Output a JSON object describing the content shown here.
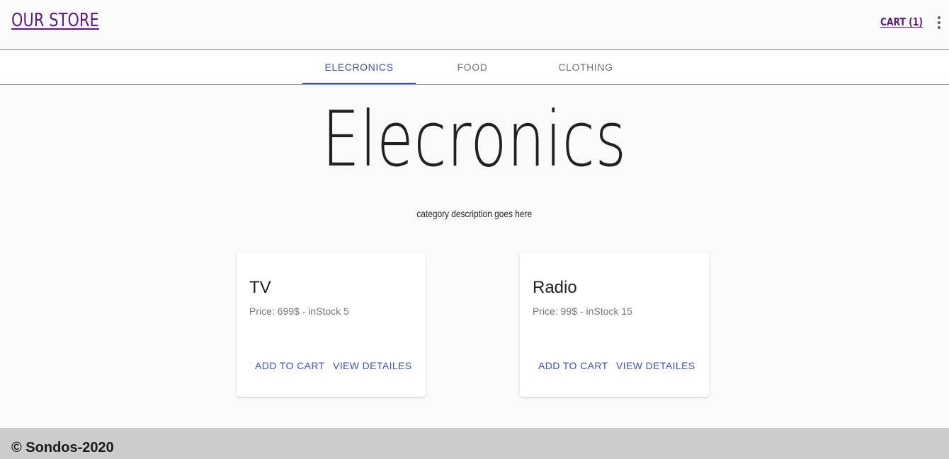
{
  "header": {
    "brand": "OUR STORE",
    "cart_label": "CART (1)",
    "menu_icon": "more-vert-icon"
  },
  "tabs": [
    {
      "label": "ELECRONICS",
      "active": true
    },
    {
      "label": "FOOD",
      "active": false
    },
    {
      "label": "CLOTHING",
      "active": false
    }
  ],
  "category": {
    "title": "Elecronics",
    "description": "category description goes here"
  },
  "products": [
    {
      "name": "TV",
      "details": "Price: 699$ - inStock 5",
      "add_label": "ADD TO CART",
      "view_label": "VIEW DETAILES"
    },
    {
      "name": "Radio",
      "details": "Price: 99$ - inStock 15",
      "add_label": "ADD TO CART",
      "view_label": "VIEW DETAILES"
    }
  ],
  "footer": {
    "text": "© Sondos-2020"
  },
  "colors": {
    "brand": "#5b1a86",
    "accent": "#3f51b5",
    "footer_bg": "#cccccc"
  }
}
